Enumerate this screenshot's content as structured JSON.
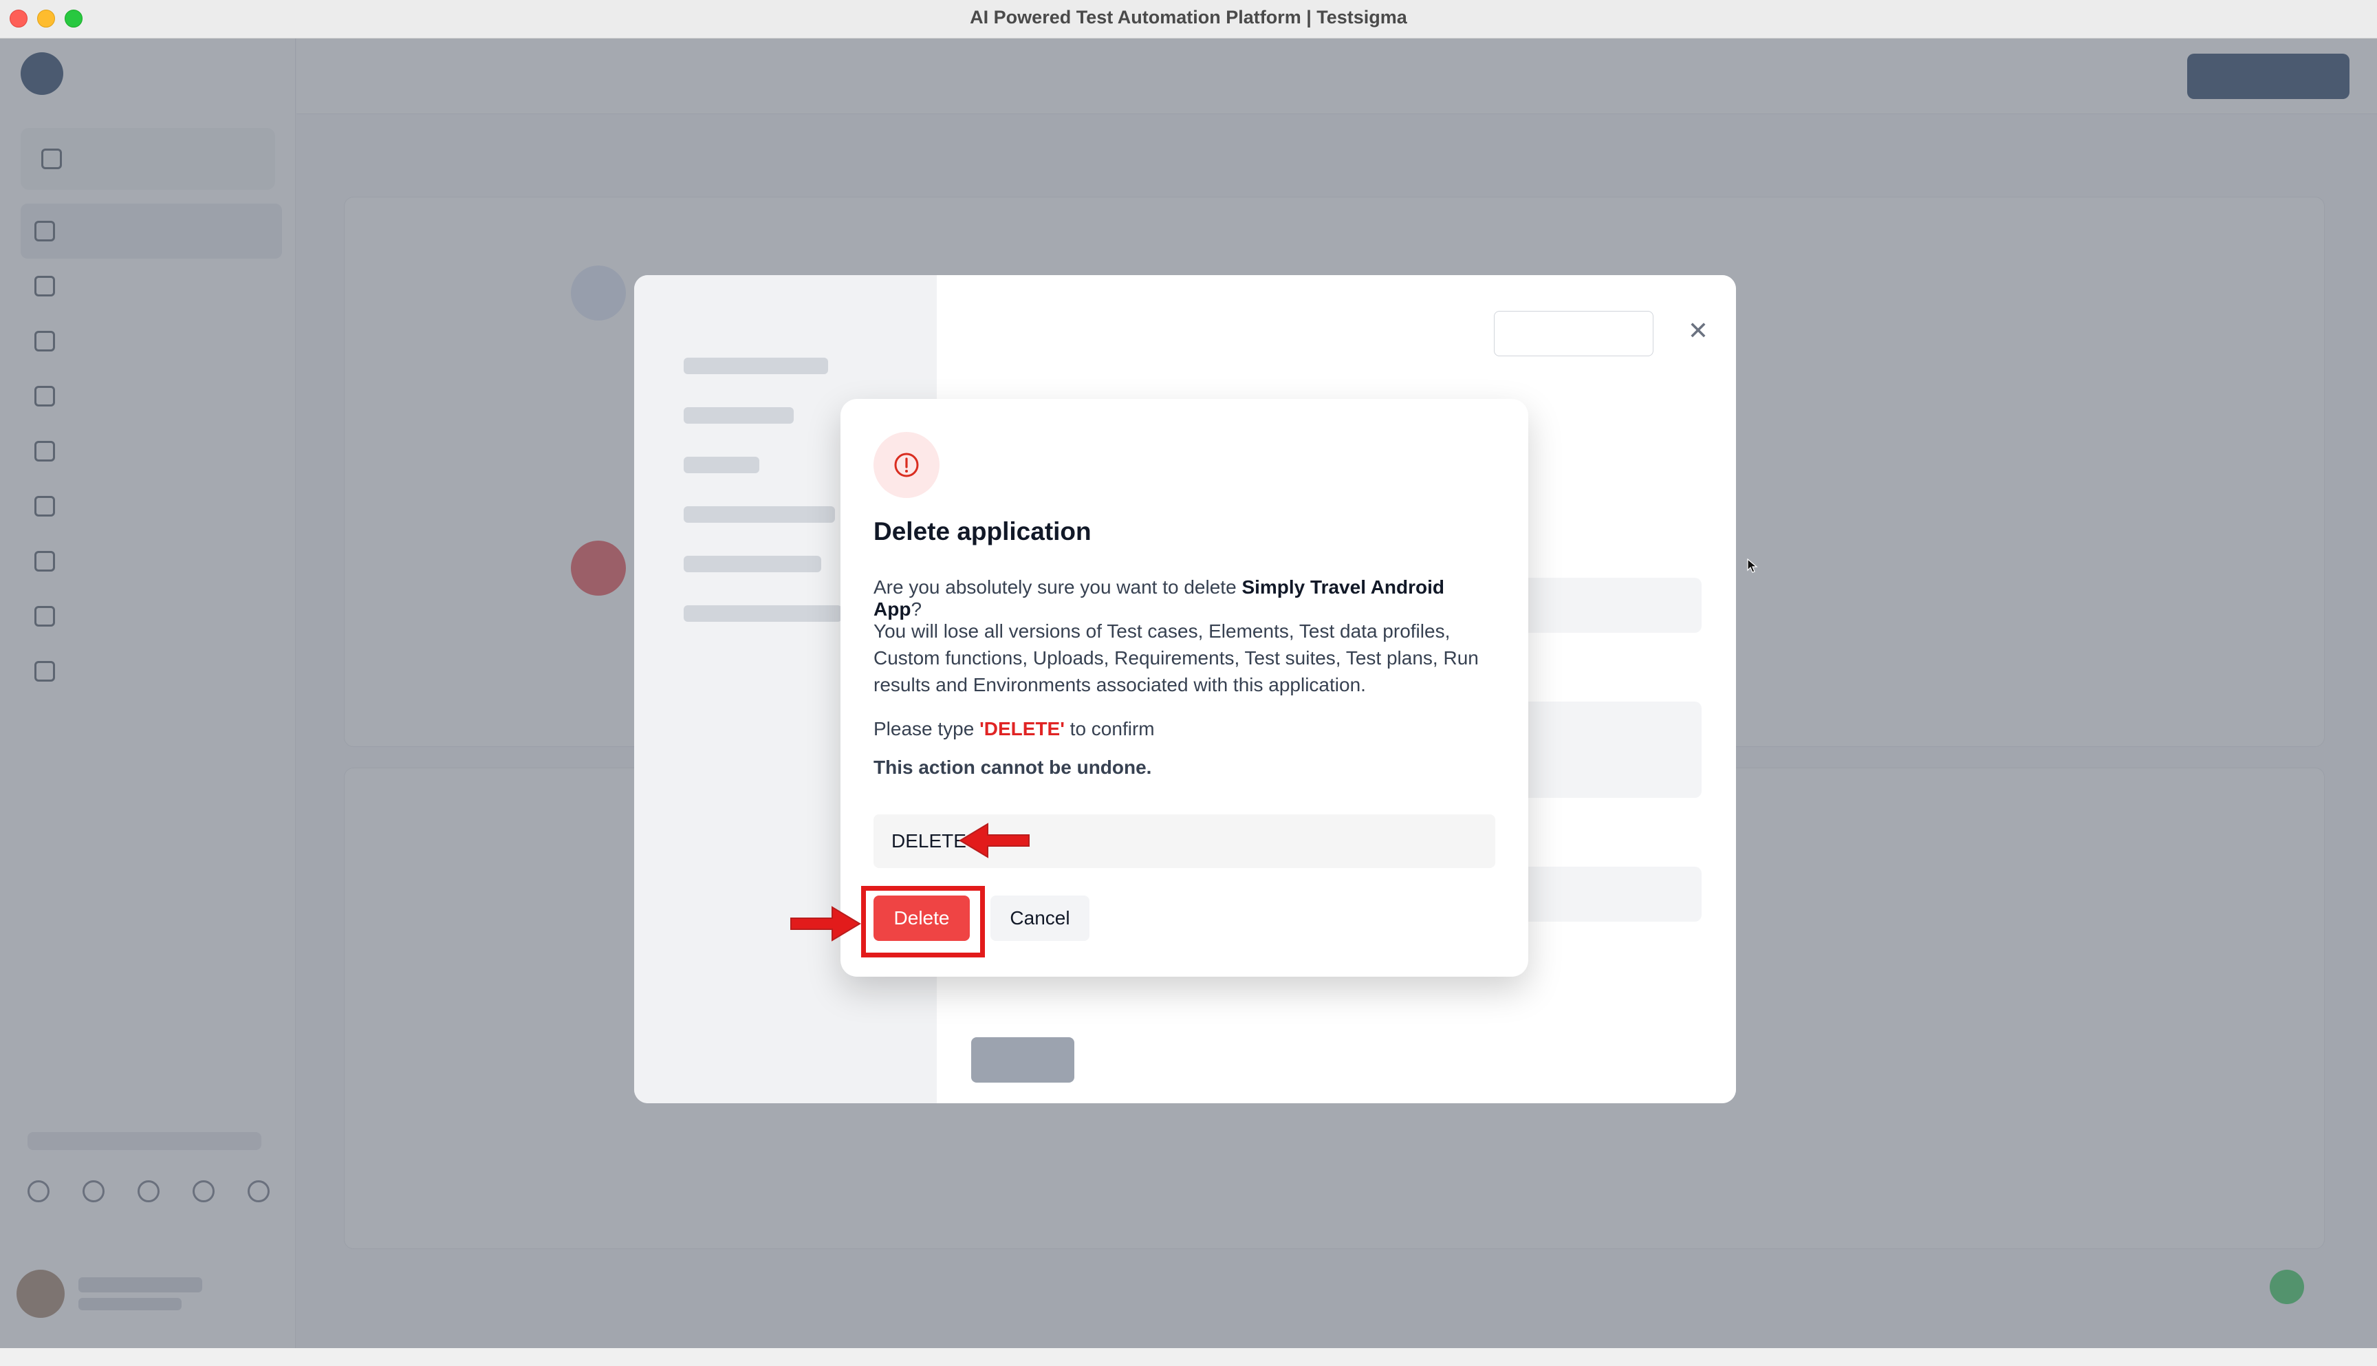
{
  "window": {
    "title": "AI Powered Test Automation Platform | Testsigma"
  },
  "colors": {
    "danger": "#ef4444",
    "brand": "#1e3a5f",
    "highlight": "#e21b1b"
  },
  "modal": {
    "icon": "warning-circle-icon",
    "title": "Delete application",
    "confirm_prefix": "Are you absolutely sure you want to delete ",
    "app_name": "Simply Travel Android App",
    "confirm_suffix": "?",
    "warning": "You will lose all versions of Test cases, Elements, Test data profiles, Custom functions, Uploads, Requirements, Test suites, Test plans, Run results and Environments associated with this application.",
    "type_prefix": "Please type ",
    "type_keyword": "'DELETE'",
    "type_suffix": " to confirm",
    "irreversible": "This action cannot be undone.",
    "input_value": "DELETE",
    "delete_label": "Delete",
    "cancel_label": "Cancel"
  }
}
